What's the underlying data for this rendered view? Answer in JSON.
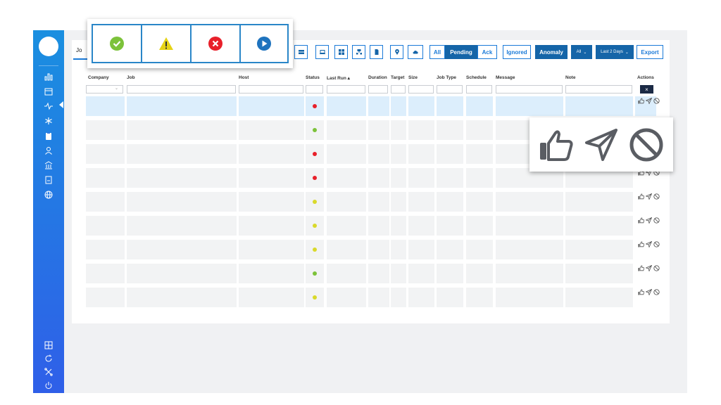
{
  "tabs": [
    {
      "label": "Jo"
    }
  ],
  "toolbar": {
    "filter_buttons": [
      "All",
      "Pending",
      "Ack",
      "Ignored",
      "Anomaly"
    ],
    "anomaly_filter": "All",
    "date_range": "Last 2 Days",
    "export_label": "Export",
    "view_icons": [
      "server-icon",
      "laptop-icon",
      "grid-icon",
      "network-icon",
      "document-icon",
      "location-pin-icon",
      "cloud-icon"
    ]
  },
  "table": {
    "columns": [
      "Company",
      "Job",
      "Host",
      "Status",
      "Last Run",
      "Duration",
      "Target",
      "Size",
      "Job Type",
      "Schedule",
      "Message",
      "Note",
      "Actions"
    ],
    "sort_indicator": "▴",
    "clear_filters_label": "×",
    "rows": [
      {
        "status": "red",
        "selected": true
      },
      {
        "status": "green"
      },
      {
        "status": "red"
      },
      {
        "status": "red"
      },
      {
        "status": "yellow"
      },
      {
        "status": "yellow"
      },
      {
        "status": "yellow"
      },
      {
        "status": "green"
      },
      {
        "status": "yellow"
      }
    ],
    "row_actions": [
      "thumbs-up-icon",
      "send-icon",
      "ignore-icon"
    ]
  },
  "status_legend": [
    "ok-check-icon",
    "warning-icon",
    "error-x-icon",
    "running-play-icon"
  ],
  "colors": {
    "accent": "#1a7ad8",
    "sidebar_top": "#1a8fe0",
    "sidebar_bottom": "#2f5fe8",
    "status_red": "#e8202a",
    "status_green": "#7cc23a",
    "status_yellow": "#d9d92b",
    "status_blue": "#1e73be"
  }
}
